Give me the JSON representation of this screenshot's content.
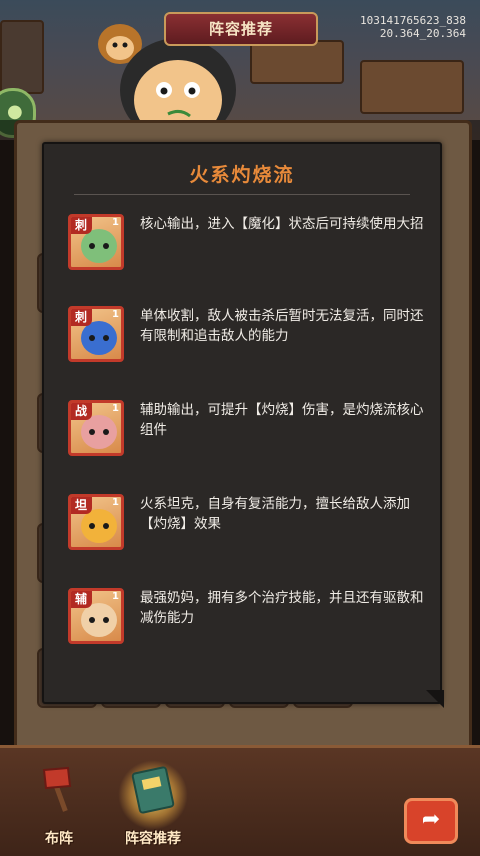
{
  "header": {
    "title": "阵容推荐",
    "build_id": [
      "103141765623_838",
      "20.364_20.364"
    ]
  },
  "popup": {
    "title": "火系灼烧流",
    "entries": [
      {
        "role": "刺",
        "count": "1",
        "desc": "核心输出，进入【魔化】状态后可持续使用大招",
        "face_color": "#7fbf7a"
      },
      {
        "role": "刺",
        "count": "1",
        "desc": "单体收割，敌人被击杀后暂时无法复活，同时还有限制和追击敌人的能力",
        "face_color": "#3a6ed0"
      },
      {
        "role": "战",
        "count": "1",
        "desc": "辅助输出，可提升【灼烧】伤害，是灼烧流核心组件",
        "face_color": "#e8a0a0"
      },
      {
        "role": "坦",
        "count": "1",
        "desc": "火系坦克，自身有复活能力，擅长给敌人添加【灼烧】效果",
        "face_color": "#f2b23a"
      },
      {
        "role": "辅",
        "count": "1",
        "desc": "最强奶妈，拥有多个治疗技能，并且还有驱散和减伤能力",
        "face_color": "#f0d0a8"
      }
    ]
  },
  "tabs": [
    {
      "label": "布阵",
      "icon": "axe-icon",
      "active": false
    },
    {
      "label": "阵容推荐",
      "icon": "book-icon",
      "active": true
    }
  ],
  "colors": {
    "accent": "#e88a3a",
    "badge": "#b22a22",
    "popup_bg": "#2b2826"
  }
}
